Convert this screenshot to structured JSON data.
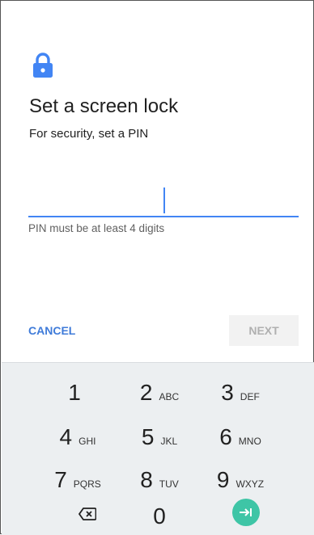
{
  "header": {
    "title": "Set a screen lock",
    "subtitle": "For security, set a PIN"
  },
  "pin_field": {
    "value": "",
    "hint": "PIN must be at least 4 digits"
  },
  "actions": {
    "cancel_label": "CANCEL",
    "next_label": "NEXT"
  },
  "keypad": {
    "keys": [
      {
        "digit": "1",
        "letters": ""
      },
      {
        "digit": "2",
        "letters": "ABC"
      },
      {
        "digit": "3",
        "letters": "DEF"
      },
      {
        "digit": "4",
        "letters": "GHI"
      },
      {
        "digit": "5",
        "letters": "JKL"
      },
      {
        "digit": "6",
        "letters": "MNO"
      },
      {
        "digit": "7",
        "letters": "PQRS"
      },
      {
        "digit": "8",
        "letters": "TUV"
      },
      {
        "digit": "9",
        "letters": "WXYZ"
      },
      {
        "digit": "0",
        "letters": ""
      }
    ],
    "backspace_icon": "backspace-icon",
    "enter_icon": "enter-icon"
  },
  "colors": {
    "accent": "#4285f4",
    "enter_button": "#3ec5a6",
    "keypad_bg": "#eceff1"
  }
}
